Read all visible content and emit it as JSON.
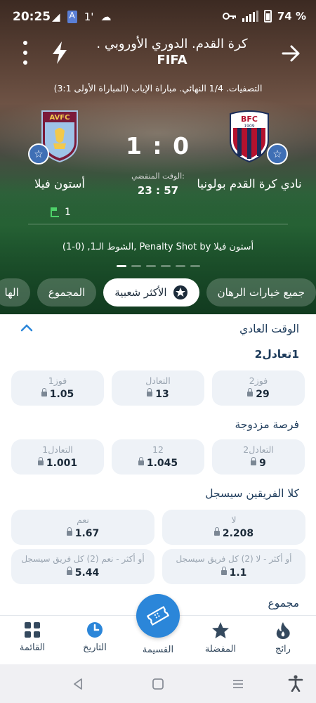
{
  "status_bar": {
    "time": "20:25",
    "battery": "74 %",
    "left_icons": [
      "◢",
      "A",
      "1'",
      "☁"
    ]
  },
  "header": {
    "title_line1": "كرة القدم. الدوري الأوروبي .",
    "title_line2": "FIFA"
  },
  "match": {
    "round": "التصفيات. 1/4 النهائي. مباراة الإياب (المباراة الأولى 3:1)",
    "home_team": "نادي كرة القدم بولونيا",
    "away_team": "أستون فيلا",
    "score": "1 : 0",
    "elapsed_label": ":الوقت المنقضي",
    "elapsed_time": "23 : 57",
    "corners_away": "1",
    "last_event": "الشوط الـ1, (0-1), Penalty Shot by أستون فيلا",
    "away_crest_text": "AVFC",
    "home_crest_text": "BFC",
    "home_crest_year": "1909",
    "slide_count": 6,
    "active_slide": 0
  },
  "tabs": [
    "جميع خيارات الرهان",
    "الأكثر شعبية",
    "المجموع",
    "الها"
  ],
  "active_tab": 1,
  "markets": {
    "regular_time": "الوقت العادي",
    "m1x2": {
      "title": "1تعادل2",
      "odds": [
        {
          "label": "فوز1",
          "value": "1.05"
        },
        {
          "label": "التعادل",
          "value": "13"
        },
        {
          "label": "فوز2",
          "value": "29"
        }
      ]
    },
    "double_chance": {
      "title": "فرصة مزدوجة",
      "odds": [
        {
          "label": "التعادل1",
          "value": "1.001"
        },
        {
          "label": "12",
          "value": "1.045"
        },
        {
          "label": "التعادل2",
          "value": "9"
        }
      ]
    },
    "btts": {
      "title": "كلا الفريقين سيسجل",
      "odds": [
        {
          "label": "نعم",
          "value": "1.67"
        },
        {
          "label": "لا",
          "value": "2.208"
        },
        {
          "label": "أو أكثر - نعم (2) كل فريق سيسجل",
          "value": "5.44"
        },
        {
          "label": "أو أكثر - لا (2) كل فريق سيسجل",
          "value": "1.1"
        }
      ]
    },
    "total_title": "مجموع"
  },
  "bottom_nav": {
    "menu": "القائمة",
    "history": "التاريخ",
    "coupon": "القسيمة",
    "favorites": "المفضلة",
    "popular": "رائج"
  },
  "colors": {
    "accent_blue": "#2b86d9",
    "nav_text": "#34495e"
  }
}
